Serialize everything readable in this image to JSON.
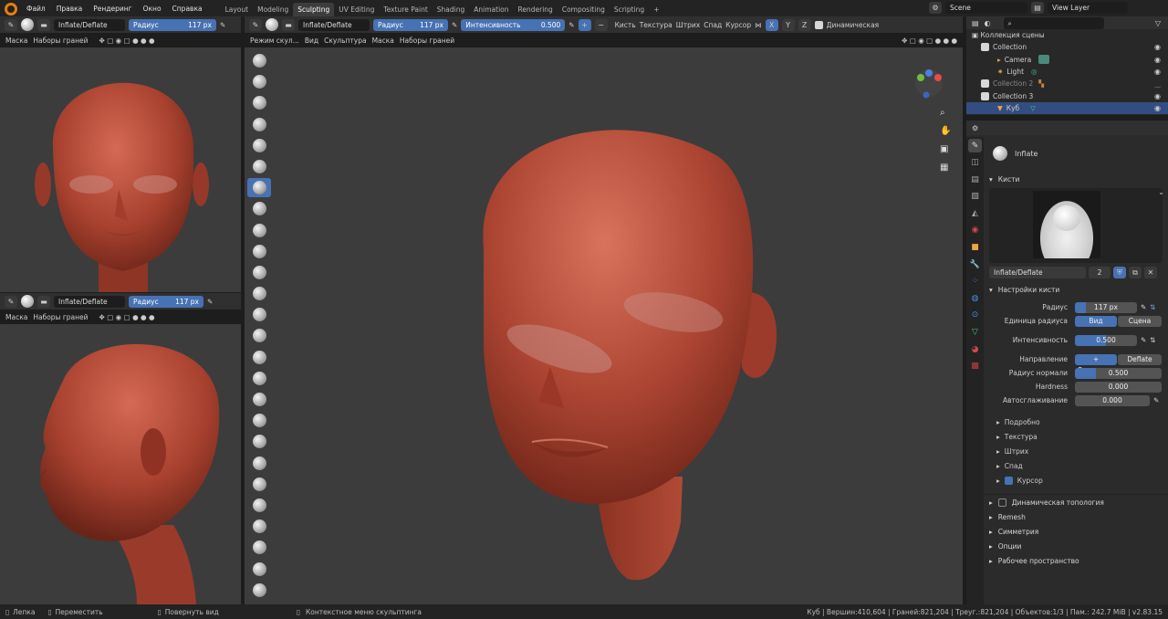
{
  "menu": {
    "file": "Файл",
    "edit": "Правка",
    "render": "Рендеринг",
    "window": "Окно",
    "help": "Справка"
  },
  "workspaces": [
    "Layout",
    "Modeling",
    "Sculpting",
    "UV Editing",
    "Texture Paint",
    "Shading",
    "Animation",
    "Rendering",
    "Compositing",
    "Scripting"
  ],
  "active_workspace": "Sculpting",
  "scene": "Scene",
  "view_layer": "View Layer",
  "brush_name": "Inflate/Deflate",
  "radius_label": "Радиус",
  "radius_value": "117 px",
  "strength_label": "Интенсивность",
  "strength_value": "0.500",
  "main_header": {
    "brush_menu": "Кисть",
    "texture": "Текстура",
    "stroke": "Штрих",
    "falloff": "Спад",
    "cursor": "Курсор",
    "axis_x": "X",
    "axis_y": "Y",
    "axis_z": "Z",
    "dyntopo": "Динамическая"
  },
  "viewport_menu": {
    "mode": "Режим скул...",
    "view": "Вид",
    "sculpt": "Скульптура",
    "mask": "Маска",
    "face_sets": "Наборы граней"
  },
  "left_menu": {
    "mask": "Маска",
    "face_sets": "Наборы граней"
  },
  "outliner": {
    "title": "Коллекция сцены",
    "items": [
      {
        "label": "Collection"
      },
      {
        "label": "Camera"
      },
      {
        "label": "Light"
      },
      {
        "label": "Collection 2"
      },
      {
        "label": "Collection 3"
      },
      {
        "label": "Куб"
      }
    ]
  },
  "properties": {
    "brush_title": "Inflate",
    "brushes_section": "Кисти",
    "brush_field": "Inflate/Deflate",
    "brush_users": "2",
    "settings_section": "Настройки кисти",
    "rows": {
      "radius": {
        "label": "Радиус",
        "value": "117 px"
      },
      "radius_unit": {
        "label": "Единица радиуса",
        "view": "Вид",
        "scene": "Сцена"
      },
      "strength": {
        "label": "Интенсивность",
        "value": "0.500"
      },
      "direction": {
        "label": "Направление",
        "inflate": "+ Раздува...",
        "deflate": "Deflate"
      },
      "normal_radius": {
        "label": "Радиус нормали",
        "value": "0.500"
      },
      "hardness": {
        "label": "Hardness",
        "value": "0.000"
      },
      "autosmooth": {
        "label": "Автосглаживание",
        "value": "0.000"
      }
    },
    "subsections": [
      "Подробно",
      "Текстура",
      "Штрих",
      "Спад"
    ],
    "cursor_sub": "Курсор",
    "sections": [
      "Динамическая топология",
      "Remesh",
      "Симметрия",
      "Опции",
      "Рабочее пространство"
    ]
  },
  "statusbar": {
    "left1": "Лепка",
    "left2": "Переместить",
    "left3": "Повернуть вид",
    "left4": "Контекстное меню скульптинга",
    "stats": "Куб | Вершин:410,604 | Граней:821,204 | Треуг.:821,204 | Объектов:1/3 | Пам.: 242.7 MiB | v2.83.15"
  },
  "colors": {
    "accent": "#4772b3",
    "skin": "#b24a3c",
    "viewport_bg": "#3c3c3c"
  }
}
